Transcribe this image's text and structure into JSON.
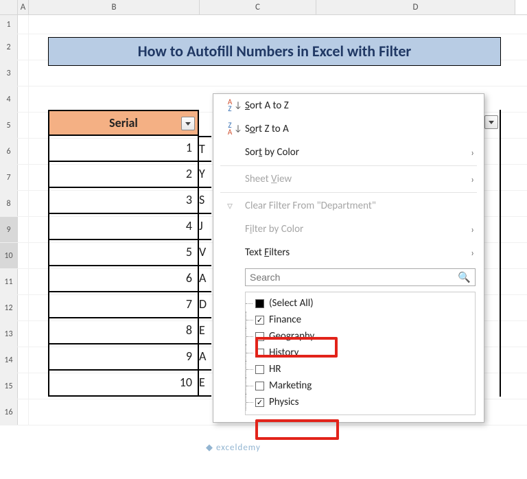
{
  "columns": {
    "A": "A",
    "B": "B",
    "C": "C",
    "D": "D"
  },
  "rows": [
    "1",
    "2",
    "3",
    "4",
    "5",
    "6",
    "7",
    "8",
    "9",
    "10",
    "11",
    "12",
    "13",
    "14",
    "15",
    "16"
  ],
  "title": "How to Autofill Numbers in Excel with Filter",
  "header": {
    "serial": "Serial"
  },
  "serials": [
    "1",
    "2",
    "3",
    "4",
    "5",
    "6",
    "7",
    "8",
    "9",
    "10"
  ],
  "partials": [
    "T",
    "Y",
    "S",
    "J",
    "V",
    "A",
    "D",
    "E",
    "A",
    "E"
  ],
  "menu": {
    "sort_az": "Sort A to Z",
    "sort_za": "Sort Z to A",
    "sort_color": "Sort by Color",
    "sheet_view": "Sheet View",
    "clear": "Clear Filter From \"Department\"",
    "filter_color": "Filter by Color",
    "text_filters": "Text Filters",
    "search_ph": "Search"
  },
  "items": {
    "select_all": "(Select All)",
    "finance": "Finance",
    "geography": "Geography",
    "history": "History",
    "hr": "HR",
    "marketing": "Marketing",
    "physics": "Physics"
  },
  "watermark": "exceldemy"
}
